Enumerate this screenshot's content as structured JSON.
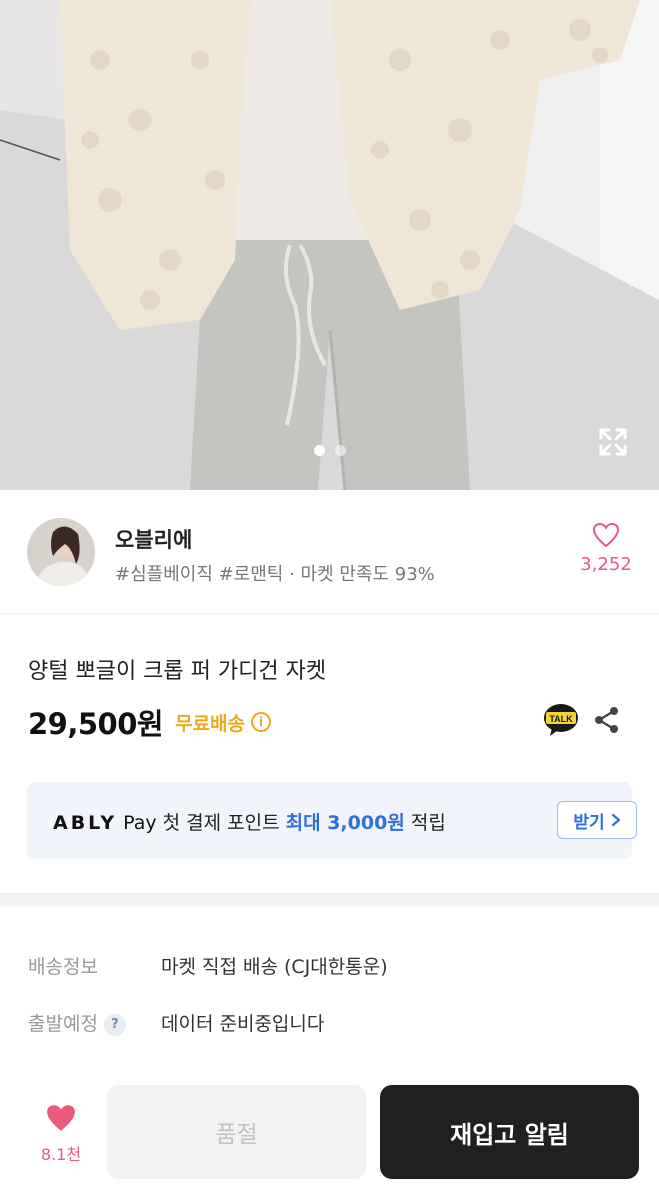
{
  "hero": {
    "image_alt": "",
    "slide_count": 2,
    "active_slide": 0
  },
  "seller": {
    "name": "오블리에",
    "tags": "#심플베이직 #로맨틱 · 마켓 만족도 93%",
    "like_count": "3,252"
  },
  "product": {
    "title": "양털 뽀글이 크롭 퍼 가디건 자켓",
    "price": "29,500원",
    "shipping_badge": "무료배송"
  },
  "promo": {
    "brand": "ABLY",
    "pay": "Pay",
    "text_before": "첫 결제 포인트 ",
    "highlight": "최대 3,000원",
    "text_after": " 적립",
    "button_label": "받기"
  },
  "shipping": {
    "rows": [
      {
        "label": "배송정보",
        "value": "마켓 직접 배송 (CJ대한통운)"
      },
      {
        "label": "출발예정",
        "value": "데이터 준비중입니다"
      }
    ]
  },
  "bottom_bar": {
    "like_count": "8.1천",
    "soldout_label": "품절",
    "restock_label": "재입고 알림"
  },
  "icons": {
    "talk": "kakao-talk-icon",
    "share": "share-icon",
    "expand": "expand-icon",
    "heart": "heart-icon"
  },
  "colors": {
    "accent_pink": "#ea5a7a",
    "free_shipping": "#f0a91e",
    "promo_blue": "#2f6fd6",
    "primary_button": "#202020"
  }
}
